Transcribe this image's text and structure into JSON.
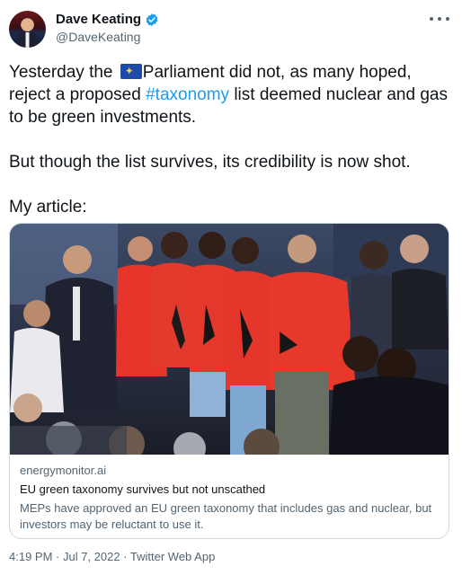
{
  "author": {
    "name": "Dave Keating",
    "handle": "@DaveKeating"
  },
  "tweet": {
    "line1_prefix": "Yesterday the ",
    "line1_suffix": "Parliament did not, as many hoped, reject a proposed ",
    "hashtag": "#taxonomy",
    "line1_end": " list deemed nuclear and gas to be green investments.",
    "paragraph2": "But though the list survives, its credibility is now shot.",
    "paragraph3": "My article:"
  },
  "card": {
    "domain": "energymonitor.ai",
    "title": "EU green taxonomy survives but not unscathed",
    "description": "MEPs have approved an EU green taxonomy that includes gas and nuclear, but investors may be reluctant to use it."
  },
  "timestamp": "4:19 PM · Jul 7, 2022 · Twitter Web App",
  "icons": {
    "verified": "verified-badge-icon",
    "more": "more-options-icon",
    "flag": "eu-flag-icon"
  },
  "colors": {
    "link": "#1d9bf0",
    "secondary_text": "#536471",
    "border": "#cfd9de"
  }
}
